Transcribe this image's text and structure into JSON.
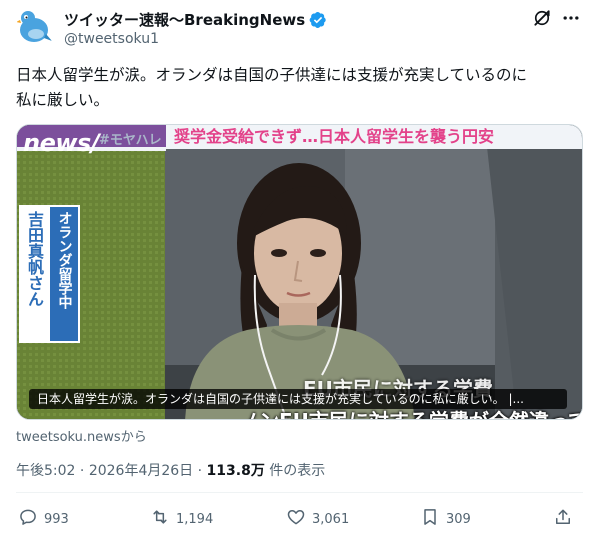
{
  "account": {
    "display_name": "ツイッター速報〜BreakingNews",
    "handle": "@tweetsoku1",
    "avatar_icon": "bird-avatar-icon",
    "verified_icon": "verified-badge-icon",
    "verified_color": "#1d9bf0"
  },
  "header_actions": {
    "grok_icon": "grok-icon",
    "more_icon": "more-dots-icon"
  },
  "tweet": {
    "text_line1": "日本人留学生が涙。オランダは自国の子供達には支援が充実しているのに",
    "text_line2": "私に厳しい。"
  },
  "media": {
    "logo": "news/",
    "hashtag": "#モヤハレ",
    "headline": "奨学金受給できず…日本人留学生を襲う円安",
    "name_plate_line1": "オランダ留学中",
    "name_plate_line2": "吉田真帆さん",
    "caption": "日本人留学生が涙。オランダは自国の子供達には支援が充実しているのに私に厳しい。 |...",
    "subtitle_top": "EU市民に対する学費",
    "subtitle_bottom": "ノンEU市民に対する学費が全然違っていて"
  },
  "source_link": "tweetsoku.newsから",
  "meta": {
    "time": "午後5:02",
    "separator": " · ",
    "date": "2026年4月26日",
    "views": "113.8万",
    "views_suffix": " 件の表示"
  },
  "actions": {
    "reply_count": "993",
    "retweet_count": "1,194",
    "like_count": "3,061",
    "bookmark_count": "309",
    "reply_icon": "reply-icon",
    "retweet_icon": "retweet-icon",
    "like_icon": "heart-icon",
    "bookmark_icon": "bookmark-icon",
    "share_icon": "share-icon"
  },
  "colors": {
    "text_primary": "#0f1419",
    "text_secondary": "#536471",
    "border": "#cfd9de",
    "headline_pink": "#e3428a",
    "name_plate_blue": "#2c6db7",
    "news_band_purple": "#7c4f9c"
  }
}
